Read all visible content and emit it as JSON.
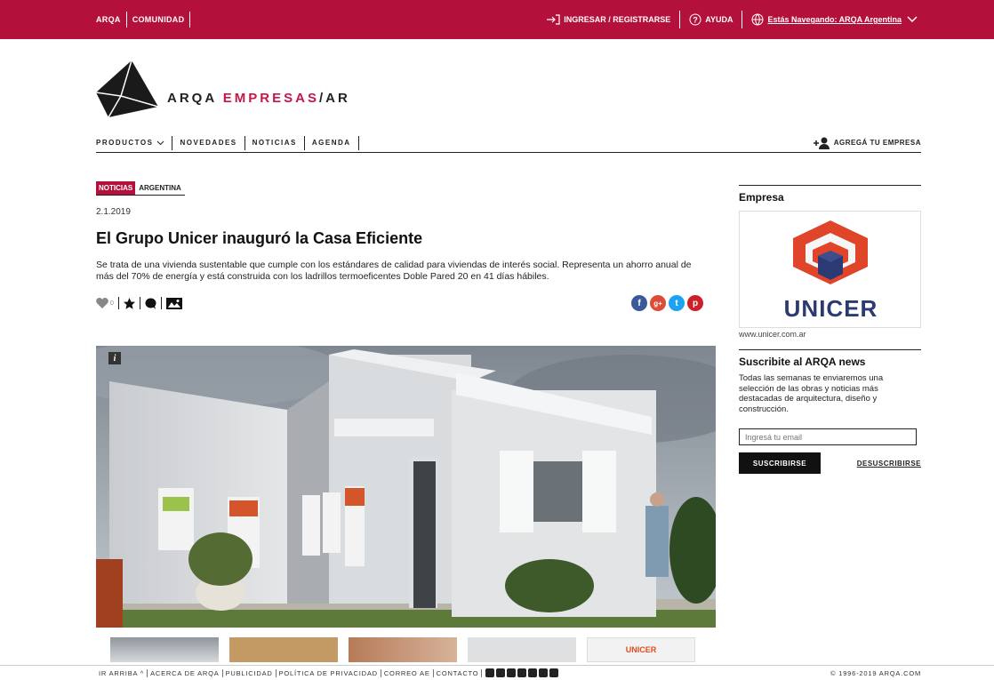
{
  "topbar": {
    "left_links": [
      "ARQA",
      "COMUNIDAD"
    ],
    "login": "INGRESAR / REGISTRARSE",
    "help": "AYUDA",
    "region": "Estás Navegando: ARQA Argentina",
    "color": "#b3113c"
  },
  "brand": {
    "part1": "ARQA ",
    "part2": "EMPRESAS",
    "part3": "/AR",
    "accent": "#c8164b"
  },
  "nav": {
    "items": [
      "PRODUCTOS",
      "NOVEDADES",
      "NOTICIAS",
      "AGENDA"
    ],
    "add_company": "AGREGÁ TU EMPRESA"
  },
  "article": {
    "tag_primary": "NOTICIAS",
    "tag_secondary": "ARGENTINA",
    "date": "2.1.2019",
    "title": "El Grupo Unicer inauguró la Casa Eficiente",
    "lead": "Se trata de una vivienda sustentable que cumple con los estándares de calidad para viviendas de interés social. Representa un ahorro anual de más del 70% de energía y está construida con los ladrillos termoeficentes Doble Pared 20 en 41 días hábiles.",
    "likes": "0",
    "social": [
      "f",
      "g+",
      "t",
      "p"
    ],
    "info": "i"
  },
  "sidebar": {
    "company_heading": "Empresa",
    "company_name": "UNICER",
    "company_url": "www.unicer.com.ar",
    "news_heading": "Suscribite al ARQA news",
    "news_desc": "Todas las semanas te enviaremos una selección de las obras y noticias más destacadas de arquitectura, diseño y construcción.",
    "email_placeholder": "Ingresá tu email",
    "subscribe": "SUSCRIBIRSE",
    "unsubscribe": "DESUSCRIBIRSE"
  },
  "footer": {
    "back_top": "IR ARRIBA",
    "links": [
      "ACERCA DE ARQA",
      "PUBLICIDAD",
      "POLÍTICA DE PRIVACIDAD",
      "CORREO AE",
      "CONTACTO"
    ],
    "copyright": "© 1996-2019 ARQA.COM"
  }
}
